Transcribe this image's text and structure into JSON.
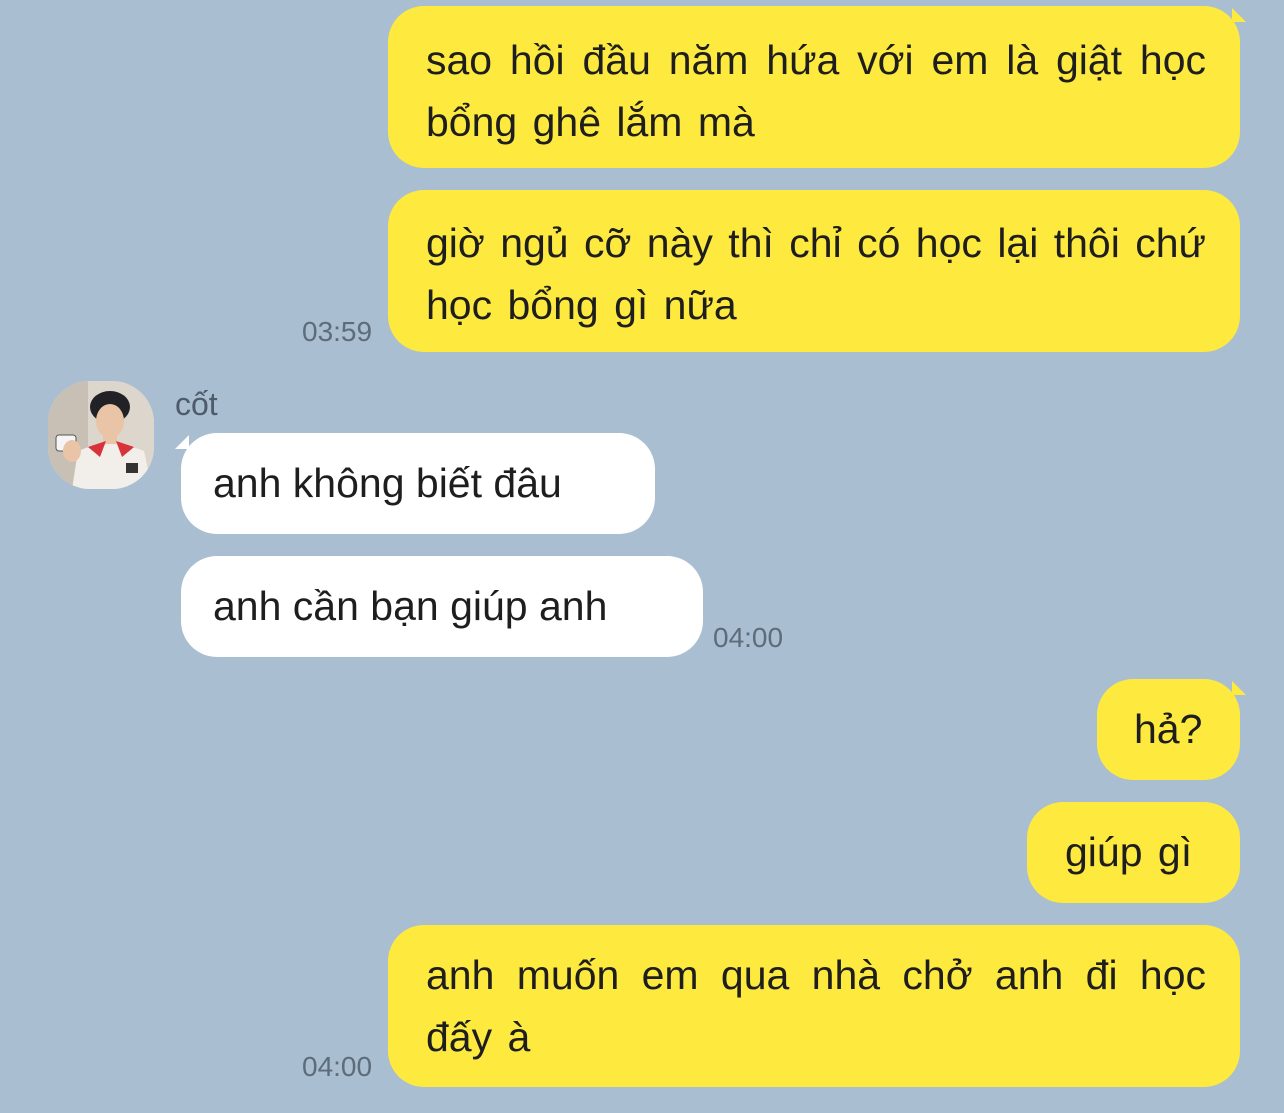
{
  "chat": {
    "contact": {
      "name": "cốt",
      "avatar_icon": "profile-photo"
    },
    "messages": [
      {
        "id": "m1",
        "from": "me",
        "text": "sao hồi đầu năm hứa với em là giật học bổng ghê lắm mà",
        "time": ""
      },
      {
        "id": "m2",
        "from": "me",
        "text": "giờ ngủ cỡ này thì chỉ có học lại thôi chứ học bổng gì nữa",
        "time": "03:59"
      },
      {
        "id": "m3",
        "from": "them",
        "text": "anh không biết đâu",
        "time": ""
      },
      {
        "id": "m4",
        "from": "them",
        "text": "anh cần bạn giúp anh",
        "time": "04:00"
      },
      {
        "id": "m5",
        "from": "me",
        "text": "hả?",
        "time": ""
      },
      {
        "id": "m6",
        "from": "me",
        "text": "giúp gì",
        "time": ""
      },
      {
        "id": "m7",
        "from": "me",
        "text": "anh muốn em qua nhà chở anh đi học đấy à",
        "time": "04:00"
      }
    ]
  },
  "colors": {
    "background": "#a9bed1",
    "outgoing_bubble": "#fee93f",
    "incoming_bubble": "#ffffff",
    "timestamp": "#5d6c7a"
  }
}
